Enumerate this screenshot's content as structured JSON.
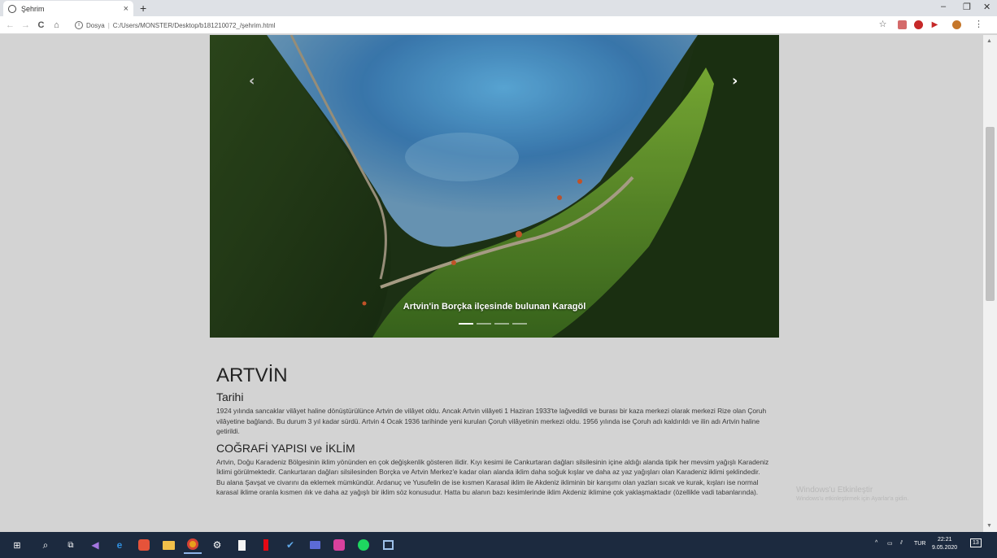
{
  "browser": {
    "tab_title": "Şehrim",
    "tab_close": "×",
    "new_tab": "+",
    "back": "←",
    "forward": "→",
    "reload": "C",
    "home": "⌂",
    "info_icon": "i",
    "address_label": "Dosya",
    "address_url": "C:/Users/MONSTER/Desktop/b181210072_/şehrim.html",
    "star": "☆",
    "menu": "⋮",
    "minimize": "–",
    "maximize": "❐",
    "close": "✕"
  },
  "carousel": {
    "caption": "Artvin'in Borçka ilçesinde bulunan Karagöl",
    "prev": "‹",
    "next": "›",
    "slide_count": 4,
    "active_slide": 1
  },
  "article": {
    "city": "ARTVİN",
    "history_title": "Tarihi",
    "history_text": "1924 yılında sancaklar vilâyet haline dönüştürülünce Artvin de vilâyet oldu. Ancak Artvin vilâyeti 1 Haziran 1933'te lağvedildi ve burası bir kaza merkezi olarak merkezi Rize olan Çoruh vilâyetine bağlandı. Bu durum 3 yıl kadar sürdü. Artvin 4 Ocak 1936 tarihinde yeni kurulan Çoruh vilâyetinin merkezi oldu. 1956 yılında ise Çoruh adı kaldırıldı ve ilin adı Artvin haline getirildi.",
    "geo_title": "COĞRAFİ YAPISI ve İKLİM",
    "geo_text": "Artvin, Doğu Karadeniz Bölgesinin iklim yönünden en çok değişkenlik gösteren ilidir. Kıyı kesimi ile Cankurtaran dağları silsilesinin içine aldığı alanda tipik her mevsim yağışlı Karadeniz İklimi görülmektedir. Cankurtaran dağları silsilesinden Borçka ve Artvin Merkez'e kadar olan alanda iklim daha soğuk kışlar ve daha az yaz yağışları olan Karadeniz iklimi şeklindedir. Bu alana Şavşat ve civarını da eklemek mümkündür. Ardanuç ve Yusufelin de ise kısmen Karasal iklim ile Akdeniz ikliminin bir karışımı olan yazları sıcak ve kurak, kışları ise normal karasal iklime oranla kısmen ılık ve daha az yağışlı bir iklim söz konusudur. Hatta bu alanın bazı kesimlerinde iklim Akdeniz iklimine çok yaklaşmaktadır (özellikle vadi tabanlarında)."
  },
  "watermark": {
    "line1": "Windows'u Etkinleştir",
    "line2": "Windows'u etkinleştirmek için Ayarlar'a gidin."
  },
  "taskbar": {
    "language": "TUR",
    "time": "22:21",
    "date": "9.05.2020",
    "notifications": "13"
  },
  "colors": {
    "page_bg": "#d3d3d3",
    "taskbar_bg": "#1c2a3f"
  }
}
